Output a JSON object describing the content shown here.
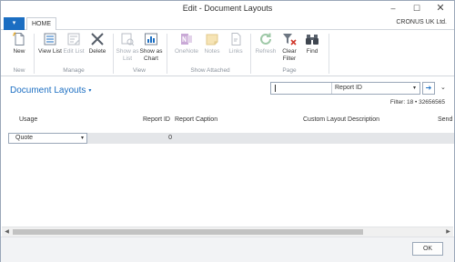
{
  "window": {
    "title": "Edit - Document Layouts",
    "controls": {
      "minimize": "–",
      "maximize": "☐",
      "close": "✕"
    }
  },
  "ribbon_tabs": {
    "app_button": "▾",
    "home": "HOME",
    "company": "CRONUS UK Ltd."
  },
  "ribbon": {
    "groups": {
      "new": "New",
      "manage": "Manage",
      "view": "View",
      "show_attached": "Show Attached",
      "page": "Page"
    },
    "buttons": {
      "new": {
        "label": "New",
        "icon": "new-document-icon",
        "enabled": true
      },
      "view_list": {
        "label": "View List",
        "icon": "view-list-icon",
        "enabled": true
      },
      "edit_list": {
        "label": "Edit List",
        "icon": "edit-list-icon",
        "enabled": false
      },
      "delete": {
        "label": "Delete",
        "icon": "delete-icon",
        "enabled": true
      },
      "show_as_list": {
        "label": "Show as List",
        "icon": "show-as-list-icon",
        "enabled": false
      },
      "show_as_chart": {
        "label": "Show as Chart",
        "icon": "show-as-chart-icon",
        "enabled": true
      },
      "onenote": {
        "label": "OneNote",
        "icon": "onenote-icon",
        "enabled": false
      },
      "notes": {
        "label": "Notes",
        "icon": "notes-icon",
        "enabled": false
      },
      "links": {
        "label": "Links",
        "icon": "links-icon",
        "enabled": false
      },
      "refresh": {
        "label": "Refresh",
        "icon": "refresh-icon",
        "enabled": false
      },
      "clear_filter": {
        "label": "Clear Filter",
        "icon": "clear-filter-icon",
        "enabled": true
      },
      "find": {
        "label": "Find",
        "icon": "binoculars-icon",
        "enabled": true
      }
    }
  },
  "page": {
    "title": "Document Layouts",
    "title_caret": "▾",
    "search": {
      "value": "",
      "field": "Report ID",
      "field_caret": "▾",
      "go": "➔"
    },
    "collapse": "⌄",
    "filter": "Filter: 18 • 32656565"
  },
  "grid": {
    "columns": [
      "Usage",
      "Report ID",
      "Report Caption",
      "Custom Layout Description",
      "Send"
    ],
    "rows": [
      {
        "usage": "Quote",
        "usage_caret": "▾",
        "report_id": "0",
        "report_caption": "",
        "custom_layout_description": "",
        "send": ""
      }
    ]
  },
  "scrollbar": {
    "left": "◀",
    "right": "▶"
  },
  "footer": {
    "ok": "OK"
  },
  "colors": {
    "accent": "#1b6ec2",
    "disabled": "#a6acb5",
    "row_fill": "#e4e6e9"
  }
}
